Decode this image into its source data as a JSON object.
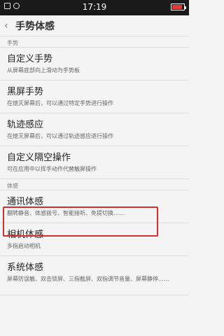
{
  "status_bar": {
    "time": "17:19"
  },
  "header": {
    "title": "手势体感"
  },
  "sections": {
    "gestures_label": "手势",
    "motion_label": "体感"
  },
  "gesture_items": [
    {
      "title": "自定义手势",
      "subtitle": "从屏幕底部向上滑动为手势板"
    },
    {
      "title": "黑屏手势",
      "subtitle": "在熄灭屏幕后，可以通过特定手势进行操作"
    },
    {
      "title": "轨迹感应",
      "subtitle": "在熄灭屏幕后，可以通过轨迹感应进行操作"
    },
    {
      "title": "自定义隔空操作",
      "subtitle": "可在应用中以挥手动作代替触屏操作"
    }
  ],
  "motion_items": [
    {
      "title": "通讯体感",
      "subtitle": "翻转静音、体感拨号、智能接听、免提切换……"
    },
    {
      "title": "相机体感",
      "subtitle": "多指启动相机"
    },
    {
      "title": "系统体感",
      "subtitle": "屏幕防误触、双击锁屏、三指截屏、双指调节音量、屏幕静停……"
    }
  ]
}
